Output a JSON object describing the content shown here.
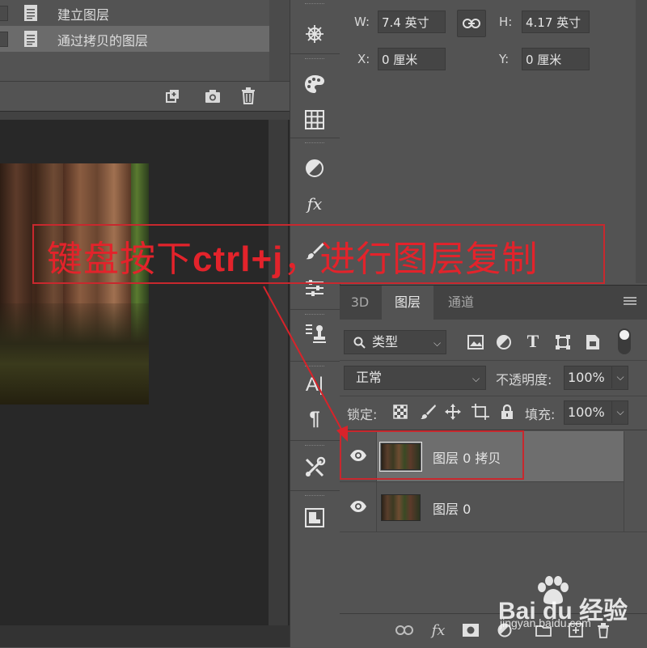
{
  "history": {
    "items": [
      {
        "label": "建立图层"
      },
      {
        "label": "通过拷贝的图层"
      }
    ],
    "toolbar": [
      "new-snapshot-icon",
      "camera-icon",
      "trash-icon"
    ]
  },
  "properties": {
    "w_label": "W:",
    "w_value": "7.4 英寸",
    "h_label": "H:",
    "h_value": "4.17 英寸",
    "x_label": "X:",
    "x_value": "0 厘米",
    "y_label": "Y:",
    "y_value": "0 厘米"
  },
  "layers_panel": {
    "tabs": [
      {
        "label": "3D",
        "active": false
      },
      {
        "label": "图层",
        "active": true
      },
      {
        "label": "通道",
        "active": false
      }
    ],
    "filter_kind": "类型",
    "blend_mode": "正常",
    "opacity_label": "不透明度:",
    "opacity_value": "100%",
    "lock_label": "锁定:",
    "fill_label": "填充:",
    "fill_value": "100%",
    "layers": [
      {
        "name": "图层 0 拷贝",
        "selected": true,
        "visible": true
      },
      {
        "name": "图层 0",
        "selected": false,
        "visible": true
      }
    ],
    "bottom_icons": [
      "link-icon",
      "fx-icon",
      "mask-icon",
      "adjustment-icon",
      "group-icon",
      "new-layer-icon",
      "trash-icon"
    ]
  },
  "tools": [
    "compass-icon",
    "palette-icon",
    "grid-icon",
    "halftone-icon",
    "fx-icon",
    "brush-icon",
    "sliders-icon",
    "stamp-icon",
    "text-a-icon",
    "paragraph-icon",
    "tools-icon",
    "library-icon"
  ],
  "annotation": {
    "text_before": "键盘按下",
    "text_bold": "ctrl+j",
    "text_after": "，进行图层复制",
    "color": "#e3232b"
  },
  "watermark": {
    "brand": "Bai du 经验",
    "url": "jingyan.baidu.com"
  }
}
